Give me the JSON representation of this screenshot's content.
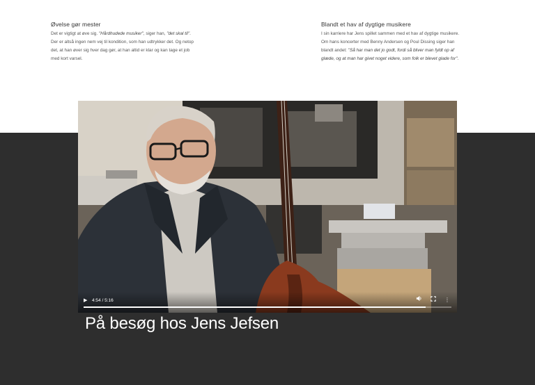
{
  "left_column": {
    "heading": "Øvelse gør mester",
    "lines": [
      {
        "plain": "Det er vigtigt at øve sig. ",
        "quote1": "\"Hårdhudede musiker\"",
        "mid": ", siger han, ",
        "quote2": "\"det skal til\"",
        "end": "."
      },
      {
        "text": "Der er altså ingen nem vej til kondition, som han udtrykker det. Og netop"
      },
      {
        "text": "det, at han øver sig hver dag gør, at han altid er klar og kan tage et job"
      },
      {
        "text": "med kort varsel."
      }
    ]
  },
  "right_column": {
    "heading": "Blandt et hav af dygtige musikere",
    "lines": [
      {
        "text": "I sin karriere har Jens spillet sammen med et hav af dygtige musikere."
      },
      {
        "text": "Om hans koncerter med Benny Andersen og Poul Dissing siger han"
      },
      {
        "plain": "blandt andet: ",
        "quote": "\"Så har man det jo godt, fordi så bliver man fyldt op af"
      },
      {
        "quote": "glæde, og at man har givet noget videre, som folk er blevet glade for\"",
        "end": "."
      }
    ]
  },
  "video": {
    "time": "4:54 / 5:16",
    "progress": 0.93,
    "icons": {
      "play": "play-icon",
      "volume": "volume-icon",
      "fullscreen": "fullscreen-icon",
      "more": "more-options-icon"
    }
  },
  "title": "På besøg hos Jens Jefsen",
  "colors": {
    "dark_band": "#2e2e2e",
    "bass_wood": "#8a3a1e"
  }
}
